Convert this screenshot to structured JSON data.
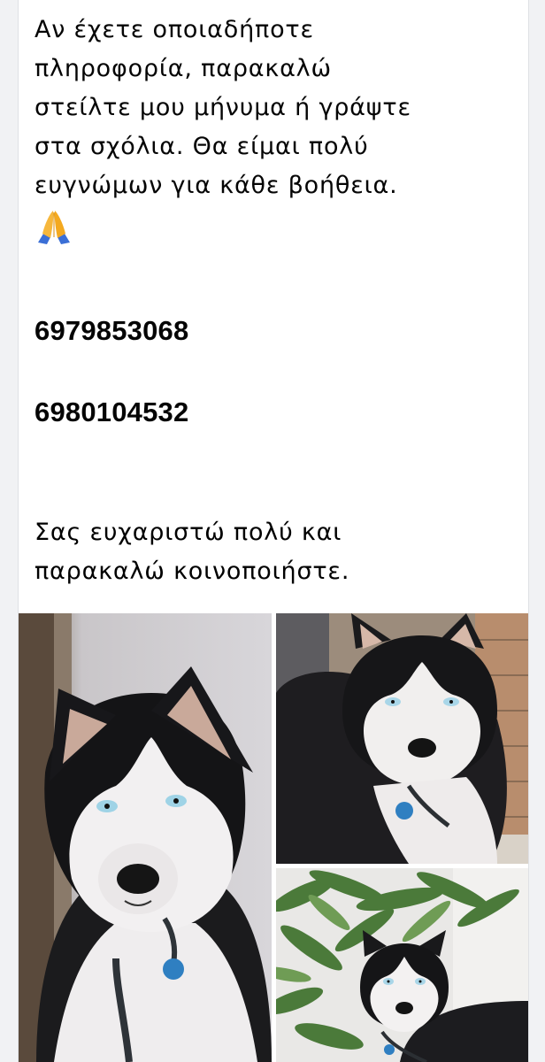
{
  "post": {
    "paragraph_1": "Αν έχετε οποιαδήποτε\nπληροφορία, παρακαλώ\nστείλτε μου μήνυμα ή γράψτε\nστα σχόλια. Θα είμαι πολύ\nευγνώμων για κάθε βοήθεια.",
    "emoji": "praying-hands-emoji",
    "phone_1": "6979853068",
    "phone_2": "6980104532",
    "paragraph_2": "Σας ευχαριστώ πολύ και\nπαρακαλώ κοινοποιήστε."
  },
  "photos": [
    {
      "subject": "husky-closeup-photo",
      "tag_color": "#2f7fc1"
    },
    {
      "subject": "husky-lying-photo",
      "tag_color": "#2f7fc1"
    },
    {
      "subject": "husky-plants-photo",
      "tag_color": "#2f7fc1"
    }
  ],
  "colors": {
    "text": "#050505",
    "card_background": "#ffffff",
    "page_background": "#f1f2f4"
  }
}
